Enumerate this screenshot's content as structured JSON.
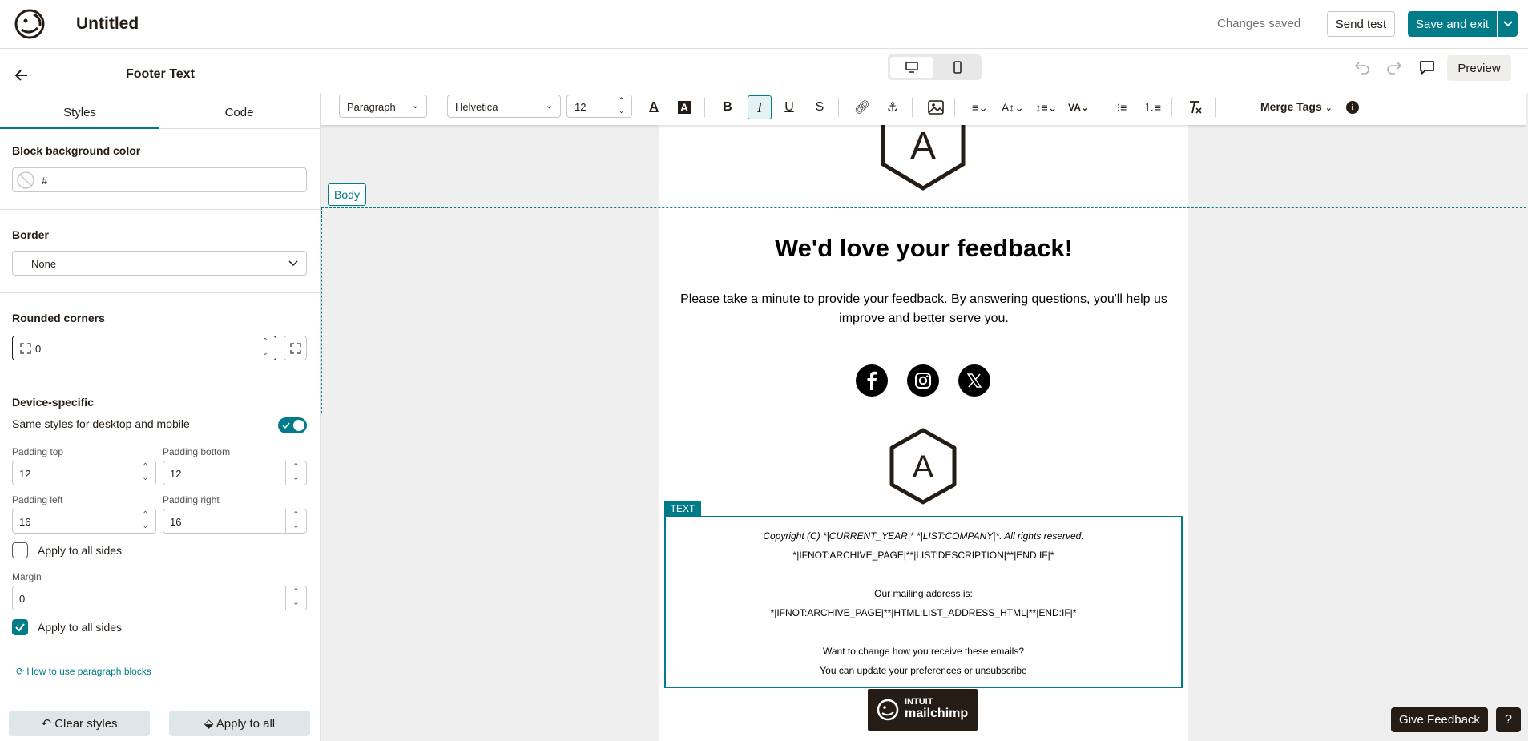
{
  "header": {
    "title": "Untitled",
    "status": "Changes saved",
    "send_test": "Send test",
    "save_exit": "Save and exit",
    "preview": "Preview"
  },
  "panel": {
    "title": "Footer Text",
    "tabs": [
      "Styles",
      "Code"
    ],
    "bg_color_label": "Block background color",
    "bg_color_value": "#",
    "border_label": "Border",
    "border_value": "None",
    "rounded_label": "Rounded corners",
    "rounded_value": "0",
    "device_label": "Device-specific",
    "same_styles_label": "Same styles for desktop and mobile",
    "padding_top_label": "Padding top",
    "padding_top": "12",
    "padding_bottom_label": "Padding bottom",
    "padding_bottom": "12",
    "padding_left_label": "Padding left",
    "padding_left": "16",
    "padding_right_label": "Padding right",
    "padding_right": "16",
    "apply_sides_1": "Apply to all sides",
    "margin_label": "Margin",
    "margin": "0",
    "apply_sides_2": "Apply to all sides",
    "help_link": "How to use paragraph blocks",
    "clear_styles": "Clear styles",
    "apply_to_all": "Apply to all"
  },
  "toolbar": {
    "block_type": "Paragraph",
    "font": "Helvetica",
    "size": "12",
    "merge_tags": "Merge Tags"
  },
  "canvas": {
    "body_tag": "Body",
    "text_tag": "TEXT",
    "heading": "We'd love your feedback!",
    "paragraph": "Please take a minute to provide your feedback. By answering questions, you'll help us improve and better serve you.",
    "logo_letter": "A",
    "footer": {
      "copyright": "Copyright (C) *|CURRENT_YEAR|* *|LIST:COMPANY|*. All rights reserved.",
      "description": "*|IFNOT:ARCHIVE_PAGE|**|LIST:DESCRIPTION|**|END:IF|*",
      "mailing_label": "Our mailing address is:",
      "address": "*|IFNOT:ARCHIVE_PAGE|**|HTML:LIST_ADDRESS_HTML|**|END:IF|*",
      "change_q": "Want to change how you receive these emails?",
      "you_can": "You can",
      "update_prefs": "update your preferences",
      "or": "or",
      "unsubscribe": "unsubscribe"
    },
    "mc_intuit": "INTUIT",
    "mc_name": "mailchimp"
  },
  "give_feedback": "Give Feedback",
  "help": "?",
  "colors": {
    "accent": "#007c89",
    "dark": "#241c15"
  }
}
